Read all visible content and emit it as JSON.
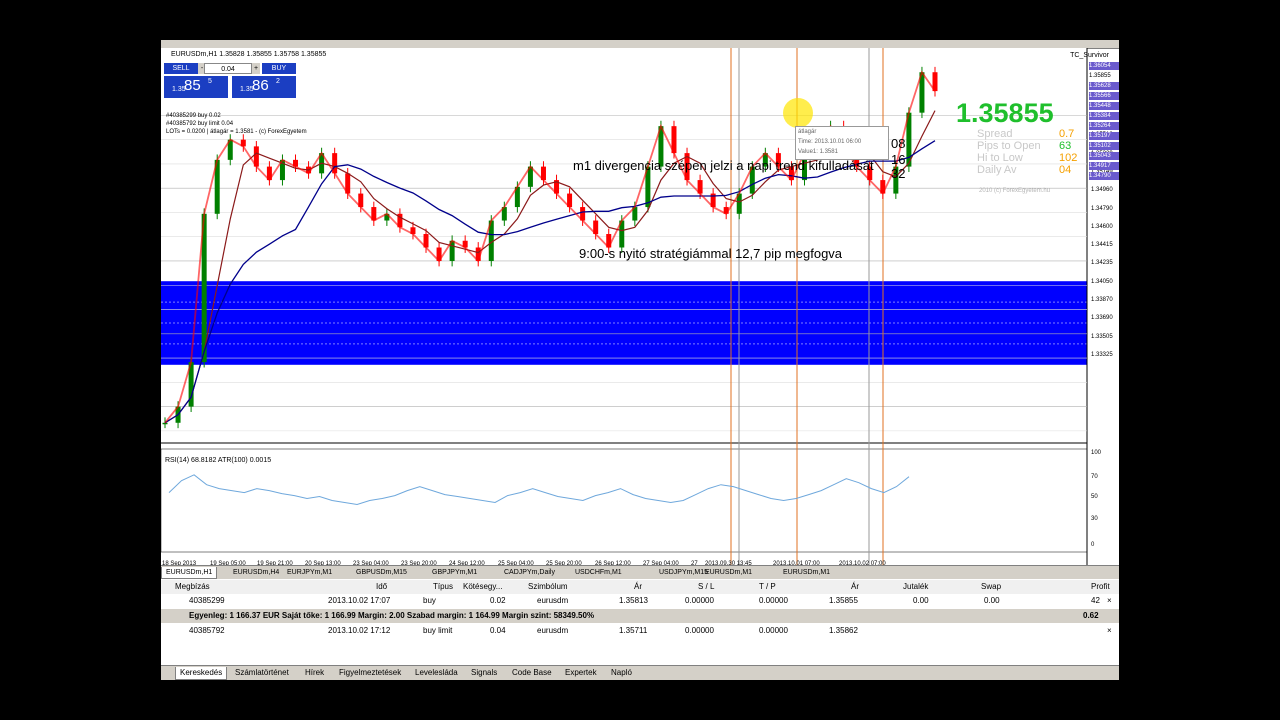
{
  "chart": {
    "symbol_title": "EURUSDm,H1  1.35828 1.35855 1.35758 1.35855",
    "indicator_name": "TC_Survivor",
    "one_click": {
      "sell_label": "SELL",
      "buy_label": "BUY",
      "lot": "0.04",
      "sell_small": "1.35",
      "sell_big": "85",
      "sell_sup": "5",
      "buy_small": "1.35",
      "buy_big": "86",
      "buy_sup": "2",
      "minus": "-",
      "plus": "+"
    },
    "info_lines": [
      "#40385299 buy 0.02",
      "#40385792 buy limit 0.04",
      "LOTs = 0.0200  |  átlagár = 1.3581  -  (c) ForexEgyetem"
    ],
    "big_price": "1.35855",
    "stats": [
      {
        "label": "Spread",
        "value": "0.7",
        "color": "#f5a000"
      },
      {
        "label": "Pips to Open",
        "value": "63",
        "color": "#1fbf2c"
      },
      {
        "label": "Hi to Low",
        "value": "102",
        "color": "#f5a000"
      },
      {
        "label": "Daily Av",
        "value": "04",
        "color": "#f5a000"
      }
    ],
    "copyright": "2010 (c) ForexEgyetem.hu",
    "annotation1": "m1 divergencia szépen jelzi a napi trend kifulladását",
    "annotation2": "9:00-s nyitó stratégiámmal 12,7 pip megfogva",
    "side_nums": [
      "08",
      "16",
      "32"
    ],
    "tooltip": {
      "title": "átlagár",
      "time": "Time: 2013.10.01 06:00",
      "value": "Value1: 1.3581"
    },
    "rsi_label": "RSI(14) 68.8182  ATR(100) 0.0015",
    "y_axis": [
      "1.35690",
      "1.35510",
      "1.35329",
      "1.35149",
      "1.34960",
      "1.34790",
      "1.34600",
      "1.34415",
      "1.34235",
      "1.34050",
      "1.33870",
      "1.33690",
      "1.33505",
      "1.33325"
    ],
    "side_labels": [
      "1.36054",
      "1.35855",
      "1.35628",
      "1.35566",
      "1.35448",
      "1.35384",
      "1.35264",
      "1.35197",
      "1.35102",
      "1.35043",
      "1.34917",
      "1.34790"
    ],
    "rsi_axis": [
      "100",
      "70",
      "50",
      "30",
      "0"
    ],
    "x_axis": [
      "18 Sep 2013",
      "19 Sep 05:00",
      "19 Sep 21:00",
      "20 Sep 13:00",
      "23 Sep 04:00",
      "23 Sep 20:00",
      "24 Sep 12:00",
      "25 Sep 04:00",
      "25 Sep 20:00",
      "26 Sep 12:00",
      "27 Sep 04:00",
      "27",
      "2013.09.30 13:45",
      "2013.10.01 07:00",
      "2013.10.02 07:00"
    ],
    "colors": {
      "band": "#0000ff",
      "candles": "#008000",
      "red_line": "#ff0000",
      "ma_dark": "#00008b",
      "ma_brown": "#8b1a1a",
      "rsi_line": "#6fa8dc"
    },
    "chart_data": {
      "type": "line",
      "price_range": [
        1.3325,
        1.3615
      ],
      "band": [
        1.3383,
        1.3445
      ],
      "price_path": [
        1.334,
        1.3352,
        1.3385,
        1.3495,
        1.3535,
        1.355,
        1.3545,
        1.353,
        1.352,
        1.3535,
        1.353,
        1.3525,
        1.354,
        1.3525,
        1.351,
        1.35,
        1.349,
        1.3495,
        1.3485,
        1.348,
        1.347,
        1.346,
        1.3475,
        1.347,
        1.346,
        1.349,
        1.35,
        1.3515,
        1.353,
        1.352,
        1.351,
        1.35,
        1.349,
        1.348,
        1.347,
        1.349,
        1.35,
        1.353,
        1.356,
        1.354,
        1.352,
        1.351,
        1.35,
        1.3495,
        1.351,
        1.353,
        1.354,
        1.353,
        1.352,
        1.354,
        1.355,
        1.356,
        1.3545,
        1.353,
        1.352,
        1.351,
        1.353,
        1.357,
        1.36,
        1.3586
      ],
      "rsi_range": [
        0,
        100
      ],
      "rsi_path": [
        58,
        70,
        76,
        66,
        62,
        60,
        58,
        62,
        60,
        57,
        55,
        52,
        54,
        50,
        48,
        46,
        50,
        52,
        55,
        60,
        64,
        60,
        56,
        54,
        52,
        50,
        48,
        55,
        58,
        62,
        58,
        54,
        52,
        50,
        55,
        58,
        62,
        56,
        52,
        50,
        48,
        50,
        56,
        62,
        66,
        64,
        60,
        56,
        52,
        50,
        52,
        56,
        60,
        66,
        72,
        68,
        62,
        58,
        64,
        74
      ]
    }
  },
  "chart_tabs": [
    "EURUSDm,H1",
    "EURUSDm,H4",
    "EURJPYm,M1",
    "GBPUSDm,M15",
    "GBPJPYm,M1",
    "CADJPYm,Daily",
    "USDCHFm,M1",
    "USDJPYm,M15",
    "EURUSDm,M1",
    "EURUSDm,M1"
  ],
  "terminal": {
    "headers": [
      "Megbízás",
      "Idő",
      "Típus",
      "Kötésegy...",
      "Szimbólum",
      "Ár",
      "S / L",
      "T / P",
      "Ár",
      "Jutalék",
      "Swap",
      "Profit"
    ],
    "rows": [
      [
        "40385299",
        "2013.10.02 17:07",
        "buy",
        "0.02",
        "eurusdm",
        "1.35813",
        "0.00000",
        "0.00000",
        "1.35855",
        "0.00",
        "0.00",
        "42"
      ],
      [
        "40385792",
        "2013.10.02 17:12",
        "buy limit",
        "0.04",
        "eurusdm",
        "1.35711",
        "0.00000",
        "0.00000",
        "1.35862",
        "",
        "",
        ""
      ]
    ],
    "balance_text": "Egyenleg: 1 166.37 EUR  Saját tőke: 1 166.99  Margin: 2.00  Szabad margin: 1 164.99  Margin szint: 58349.50%",
    "balance_profit": "0.62",
    "close_symbol": "×"
  },
  "bottom_tabs": [
    "Kereskedés",
    "Számlatörténet",
    "Hírek",
    "Figyelmeztetések",
    "Levelesláda",
    "Signals",
    "Code Base",
    "Expertek",
    "Napló"
  ]
}
